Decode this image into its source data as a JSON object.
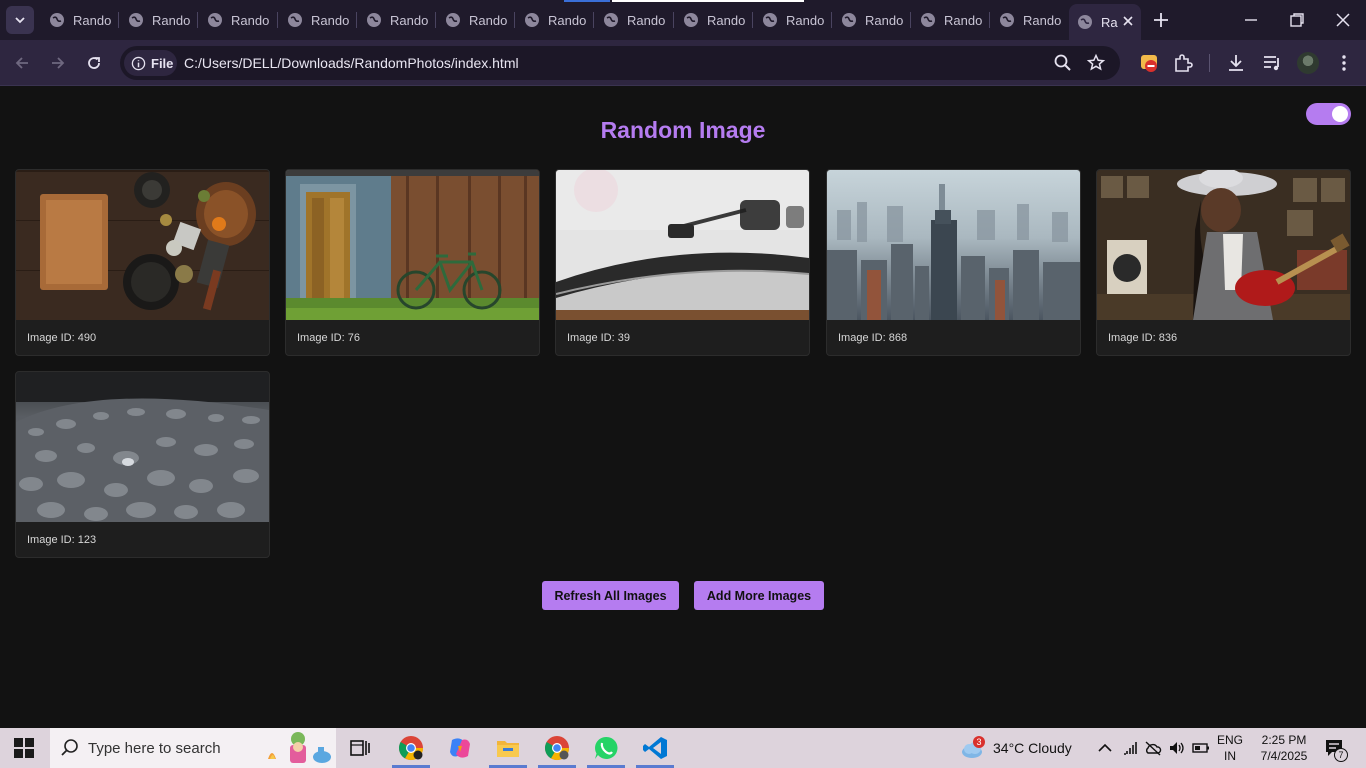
{
  "browser": {
    "tabs": [
      "Rando",
      "Rando",
      "Rando",
      "Rando",
      "Rando",
      "Rando",
      "Rando",
      "Rando",
      "Rando",
      "Rando",
      "Rando",
      "Rando",
      "Rando"
    ],
    "active_tab_label": "Ra",
    "address_chip": "File",
    "url": "C:/Users/DELL/Downloads/RandomPhotos/index.html"
  },
  "page": {
    "title": "Random Image",
    "theme_toggle_on": true,
    "cards": [
      {
        "caption": "Image ID: 490",
        "photo": "kitchen-table-still-life"
      },
      {
        "caption": "Image ID: 76",
        "photo": "barn-door-with-bicycle"
      },
      {
        "caption": "Image ID: 39",
        "photo": "record-player-closeup"
      },
      {
        "caption": "Image ID: 868",
        "photo": "foggy-city-skyline"
      },
      {
        "caption": "Image ID: 836",
        "photo": "guitarist-in-record-shop"
      },
      {
        "caption": "Image ID: 123",
        "photo": "water-droplets-texture"
      }
    ],
    "buttons": {
      "refresh": "Refresh All Images",
      "add": "Add More Images"
    },
    "accent_color": "#b57cf0"
  },
  "taskbar": {
    "search_placeholder": "Type here to search",
    "weather_badge": "3",
    "weather": "34°C  Cloudy",
    "lang_top": "ENG",
    "lang_bottom": "IN",
    "time": "2:25 PM",
    "date": "7/4/2025",
    "notification_count": "7"
  }
}
